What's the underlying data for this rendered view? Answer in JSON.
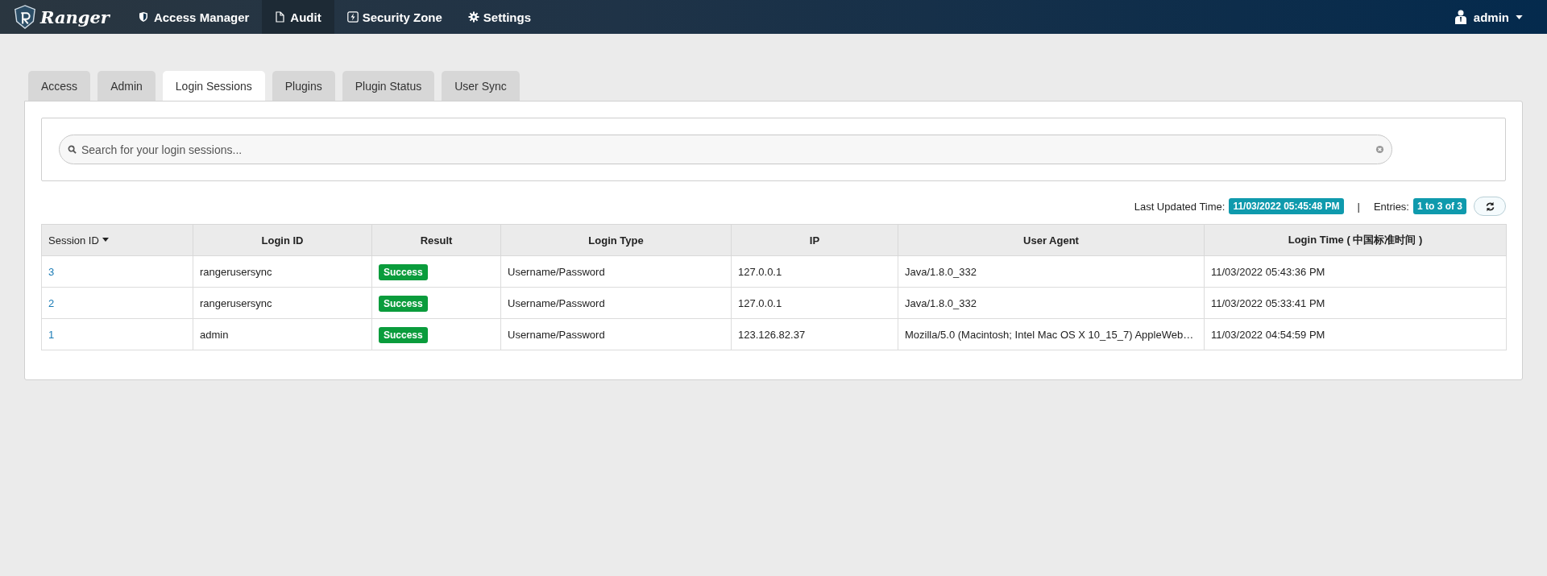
{
  "navbar": {
    "brand": "Ranger",
    "items": [
      {
        "label": "Access Manager",
        "selected": false
      },
      {
        "label": "Audit",
        "selected": true
      },
      {
        "label": "Security Zone",
        "selected": false
      },
      {
        "label": "Settings",
        "selected": false
      }
    ],
    "user": "admin"
  },
  "tabs": [
    {
      "label": "Access",
      "selected": false
    },
    {
      "label": "Admin",
      "selected": false
    },
    {
      "label": "Login Sessions",
      "selected": true
    },
    {
      "label": "Plugins",
      "selected": false
    },
    {
      "label": "Plugin Status",
      "selected": false
    },
    {
      "label": "User Sync",
      "selected": false
    }
  ],
  "search": {
    "placeholder": "Search for your login sessions..."
  },
  "info": {
    "last_updated_label": "Last Updated Time:",
    "last_updated": "11/03/2022 05:45:48 PM",
    "separator": "|",
    "entries_label": "Entries:",
    "entries": "1 to 3 of 3"
  },
  "table": {
    "columns": [
      {
        "label": "Session ID",
        "sorted": true
      },
      {
        "label": "Login ID",
        "sorted": false
      },
      {
        "label": "Result",
        "sorted": false
      },
      {
        "label": "Login Type",
        "sorted": false
      },
      {
        "label": "IP",
        "sorted": false
      },
      {
        "label": "User Agent",
        "sorted": false
      },
      {
        "label": "Login Time ( 中国标准时间 )",
        "sorted": false
      }
    ],
    "rows": [
      {
        "session_id": "3",
        "login_id": "rangerusersync",
        "result": "Success",
        "login_type": "Username/Password",
        "ip": "127.0.0.1",
        "user_agent": "Java/1.8.0_332",
        "login_time": "11/03/2022 05:43:36 PM"
      },
      {
        "session_id": "2",
        "login_id": "rangerusersync",
        "result": "Success",
        "login_type": "Username/Password",
        "ip": "127.0.0.1",
        "user_agent": "Java/1.8.0_332",
        "login_time": "11/03/2022 05:33:41 PM"
      },
      {
        "session_id": "1",
        "login_id": "admin",
        "result": "Success",
        "login_type": "Username/Password",
        "ip": "123.126.82.37",
        "user_agent": "Mozilla/5.0 (Macintosh; Intel Mac OS X 10_15_7) AppleWeb…",
        "login_time": "11/03/2022 04:54:59 PM"
      }
    ]
  }
}
